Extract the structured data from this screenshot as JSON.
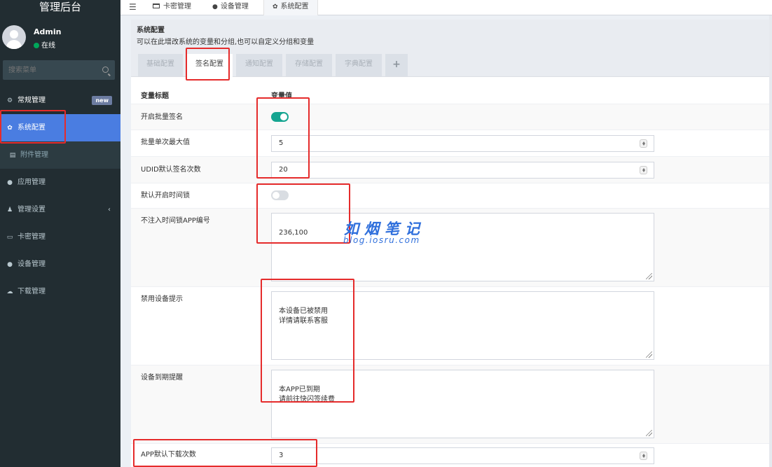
{
  "sidebar": {
    "logo": "管理后台",
    "user": {
      "name": "Admin",
      "status": "在线"
    },
    "search": {
      "placeholder": "搜索菜单"
    },
    "items": [
      {
        "label": "常规管理",
        "icon": "gears-icon",
        "badge": "new"
      },
      {
        "label": "系统配置",
        "icon": "gear-icon"
      },
      {
        "label": "附件管理",
        "icon": "file-icon"
      },
      {
        "label": "应用管理",
        "icon": "circle-icon"
      },
      {
        "label": "管理设置",
        "icon": "group-icon"
      },
      {
        "label": "卡密管理",
        "icon": "card-icon"
      },
      {
        "label": "设备管理",
        "icon": "apple-icon"
      },
      {
        "label": "下载管理",
        "icon": "cloud-download-icon"
      }
    ]
  },
  "topbar": {
    "tabs": [
      {
        "label": "卡密管理"
      },
      {
        "label": "设备管理"
      },
      {
        "label": "系统配置"
      }
    ]
  },
  "panel": {
    "title": "系统配置",
    "subtitle": "可以在此增改系统的变量和分组,也可以自定义分组和变量",
    "tabs": [
      "基础配置",
      "签名配置",
      "通知配置",
      "存储配置",
      "字典配置",
      "+"
    ],
    "columns": {
      "title": "变量标题",
      "value": "变量值"
    },
    "rows": {
      "batch_sign": {
        "label": "开启批量签名",
        "on": true
      },
      "batch_max": {
        "label": "批量单次最大值",
        "value": "5"
      },
      "udid_count": {
        "label": "UDID默认签名次数",
        "value": "20"
      },
      "time_lock": {
        "label": "默认开启时间锁",
        "on": false
      },
      "no_lock_app": {
        "label": "不注入时间锁APP编号",
        "value": "236,100"
      },
      "ban_tip": {
        "label": "禁用设备提示",
        "value": "本设备已被禁用\n详情请联系客服"
      },
      "expire_tip": {
        "label": "设备到期提醒",
        "value": "本APP已到期\n请前往快闪签续费"
      },
      "download_count": {
        "label": "APP默认下载次数",
        "value": "3"
      }
    }
  },
  "watermark": {
    "name": "如烟笔记",
    "url": "blog.iosru.com"
  },
  "colors": {
    "sidebar": "#222d32",
    "active": "#4a7de1",
    "toggle_on": "#16a591",
    "annotation": "#e52b2b"
  }
}
